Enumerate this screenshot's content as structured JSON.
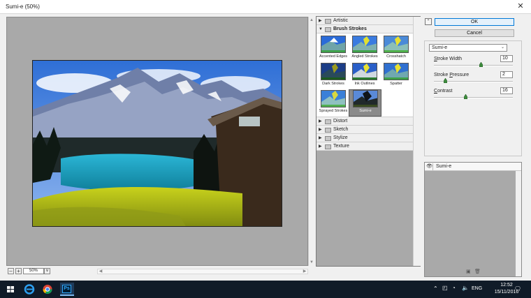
{
  "window": {
    "title": "Sumi-e (50%)",
    "close_glyph": "✕"
  },
  "preview": {
    "zoom_value": "50%",
    "minus": "–",
    "plus": "+",
    "drop": "v"
  },
  "gallery": {
    "folders_top": [
      {
        "label": "Artistic",
        "open": false
      }
    ],
    "open_folder": "Brush Strokes",
    "thumbs": [
      {
        "label": "Accented Edges",
        "selected": false
      },
      {
        "label": "Angled Strokes",
        "selected": false
      },
      {
        "label": "Crosshatch",
        "selected": false
      },
      {
        "label": "Dark Strokes",
        "selected": false
      },
      {
        "label": "Ink Outlines",
        "selected": false
      },
      {
        "label": "Spatter",
        "selected": false
      },
      {
        "label": "Sprayed Strokes",
        "selected": false
      },
      {
        "label": "Sumi-e",
        "selected": true
      }
    ],
    "folders_bottom": [
      "Distort",
      "Sketch",
      "Stylize",
      "Texture"
    ]
  },
  "buttons": {
    "ok": "OK",
    "cancel": "Cancel",
    "collapse": "⌃"
  },
  "settings": {
    "filter_select": "Sumi-e",
    "params": [
      {
        "label_u": "S",
        "label_rest": "troke Width",
        "value": "10",
        "fraction": 0.6
      },
      {
        "label_u": "",
        "label_rest": "Stroke Pressure",
        "value": "2",
        "fraction": 0.13,
        "label_u2": "P",
        "label_pre": "Stroke "
      },
      {
        "label_u": "C",
        "label_rest": "ontrast",
        "value": "16",
        "fraction": 0.4
      }
    ]
  },
  "layers": {
    "items": [
      {
        "name": "Sumi-e"
      }
    ]
  },
  "taskbar": {
    "lang": "ENG",
    "time": "12:52",
    "date": "15/11/2016",
    "ps_label": "Ps"
  },
  "colors": {
    "taskbar_bg": "#101b28",
    "accent": "#0078d7",
    "slider_knob": "#3d8b3d"
  }
}
